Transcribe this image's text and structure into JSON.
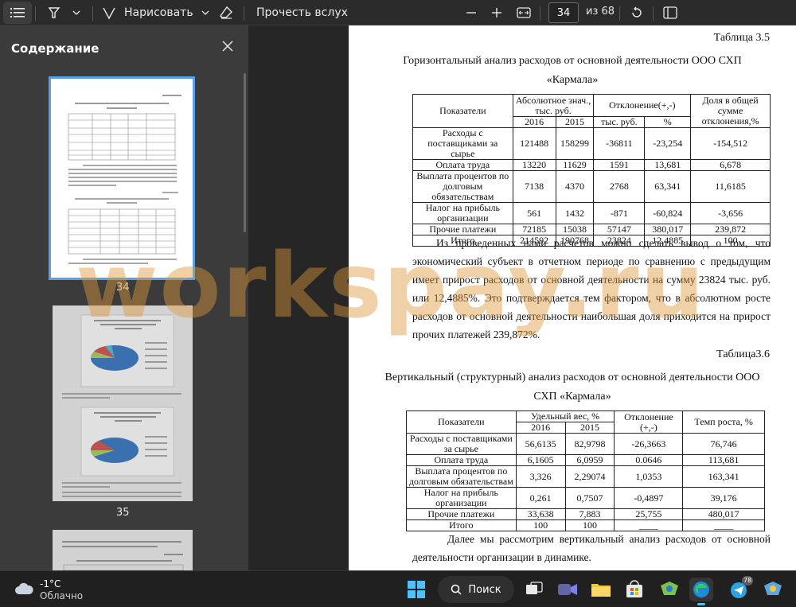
{
  "toolbar": {
    "draw_label": "Нарисовать",
    "read_aloud_label": "Прочесть вслух",
    "page_number": "34",
    "page_total": "из 68"
  },
  "sidebar": {
    "title": "Содержание",
    "thumbnails": [
      {
        "label": "34"
      },
      {
        "label": "35"
      }
    ]
  },
  "document": {
    "table1": {
      "caption": "Таблица 3.5",
      "title_line1": "Горизонтальный анализ расходов от основной деятельности ООО СХП",
      "title_line2": "«Кармала»",
      "header": {
        "col_indicator": "Показатели",
        "col_abs": "Абсолютное знач., тыс. руб.",
        "col_dev": "Отклонение(+,-)",
        "col_share": "Доля в общей сумме отклонения,%",
        "year1": "2016",
        "year2": "2015",
        "dev_rub": "тыс. руб.",
        "dev_pct": "%"
      },
      "rows": [
        {
          "name": "Расходы с поставщиками за сырье",
          "y2016": "121488",
          "y2015": "158299",
          "dev": "-36811",
          "pct": "-23,254",
          "share": "-154,512"
        },
        {
          "name": "Оплата труда",
          "y2016": "13220",
          "y2015": "11629",
          "dev": "1591",
          "pct": "13,681",
          "share": "6,678"
        },
        {
          "name": "Выплата процентов по долговым обязательствам",
          "y2016": "7138",
          "y2015": "4370",
          "dev": "2768",
          "pct": "63,341",
          "share": "11,6185"
        },
        {
          "name": "Налог на прибыль организации",
          "y2016": "561",
          "y2015": "1432",
          "dev": "-871",
          "pct": "-60,824",
          "share": "-3,656"
        },
        {
          "name": "Прочие платежи",
          "y2016": "72185",
          "y2015": "15038",
          "dev": "57147",
          "pct": "380,017",
          "share": "239,872"
        },
        {
          "name": "Итого",
          "y2016": "214592",
          "y2015": "190768",
          "dev": "23824",
          "pct": "12,4885",
          "share": "100"
        }
      ]
    },
    "paragraph1": "Из проведенных нами расчетов можно сделать вывод о том, что экономический субъект в отчетном периоде по сравнению с предыдущим имеет прирост расходов от основной деятельности на сумму 23824 тыс. руб. или 12,4885%. Это подтверждается тем фактором, что в абсолютном росте расходов от основной деятельности наибольшая доля приходится на прирост прочих платежей 239,872%.",
    "table2": {
      "caption": "Таблица3.6",
      "title_line1": "Вертикальный (структурный) анализ расходов от основной деятельности ООО",
      "title_line2": "СХП «Кармала»",
      "header": {
        "col_indicator": "Показатели",
        "col_weight": "Удельный вес, %",
        "col_dev": "Отклонение (+,-)",
        "col_rate": "Темп роста, %",
        "year1": "2016",
        "year2": "2015"
      },
      "rows": [
        {
          "name": "Расходы с поставщиками за сырье",
          "y2016": "56,6135",
          "y2015": "82,9798",
          "dev": "-26,3663",
          "rate": "76,746"
        },
        {
          "name": "Оплата труда",
          "y2016": "6,1605",
          "y2015": "6,0959",
          "dev": "0.0646",
          "rate": "113,681"
        },
        {
          "name": "Выплата процентов по долговым обязательствам",
          "y2016": "3,326",
          "y2015": "2,29074",
          "dev": "1,0353",
          "rate": "163,341"
        },
        {
          "name": "Налог на прибыль организации",
          "y2016": "0,261",
          "y2015": "0,7507",
          "dev": "-0,4897",
          "rate": "39,176"
        },
        {
          "name": "Прочие платежи",
          "y2016": "33,638",
          "y2015": "7,883",
          "dev": "25,755",
          "rate": "480,017"
        },
        {
          "name": "Итого",
          "y2016": "100",
          "y2015": "100",
          "dev": "____",
          "rate": "____"
        }
      ]
    },
    "paragraph2": "Далее мы рассмотрим вертикальный анализ расходов от основной деятельности организации в динамике."
  },
  "watermark": "workspay.ru",
  "taskbar": {
    "weather_temp": "-1°C",
    "weather_desc": "Облачно",
    "search_label": "Поиск",
    "telegram_badge": "78"
  }
}
